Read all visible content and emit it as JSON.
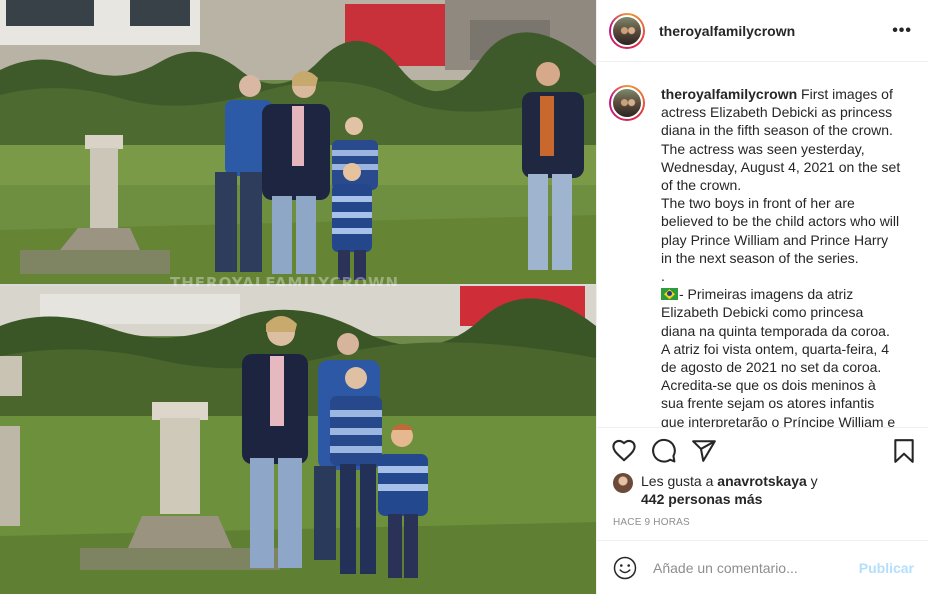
{
  "post": {
    "username": "theroyalfamilycrown",
    "more_icon": "more-horizontal-icon",
    "photo_watermark": "THEROYALFAMILYCROWN"
  },
  "caption": {
    "username": "theroyalfamilycrown",
    "text_en": " First images of actress Elizabeth Debicki as princess diana in the fifth season of the crown.\nThe actress was seen yesterday, Wednesday, August 4, 2021 on the set of the crown.\nThe two boys in front of her are believed to be the child actors who will play Prince William and Prince Harry in the next season of the series.\n.\n",
    "flag_emoji": "brazil-flag-icon",
    "text_pt": "- Primeiras imagens da atriz Elizabeth Debicki como princesa diana na quinta temporada da coroa.\nA atriz foi vista ontem, quarta-feira, 4 de agosto de 2021 no set da coroa.\nAcredita-se que os dois meninos à sua frente sejam os atores infantis que interpretarão o Príncipe William e o Príncipe Harry na próxima temporada da série."
  },
  "actions": {
    "like_icon": "heart-icon",
    "comment_icon": "comment-icon",
    "share_icon": "share-icon",
    "save_icon": "bookmark-icon"
  },
  "likes": {
    "prefix": "Les gusta a ",
    "liker": "anavrotskaya",
    "joiner": " y",
    "others": "442 personas más"
  },
  "timestamp": "HACE 9 HORAS",
  "comment": {
    "emoji_icon": "emoji-smile-icon",
    "placeholder": "Añade un comentario...",
    "publish_label": "Publicar",
    "publish_color": "#b2dffc"
  }
}
